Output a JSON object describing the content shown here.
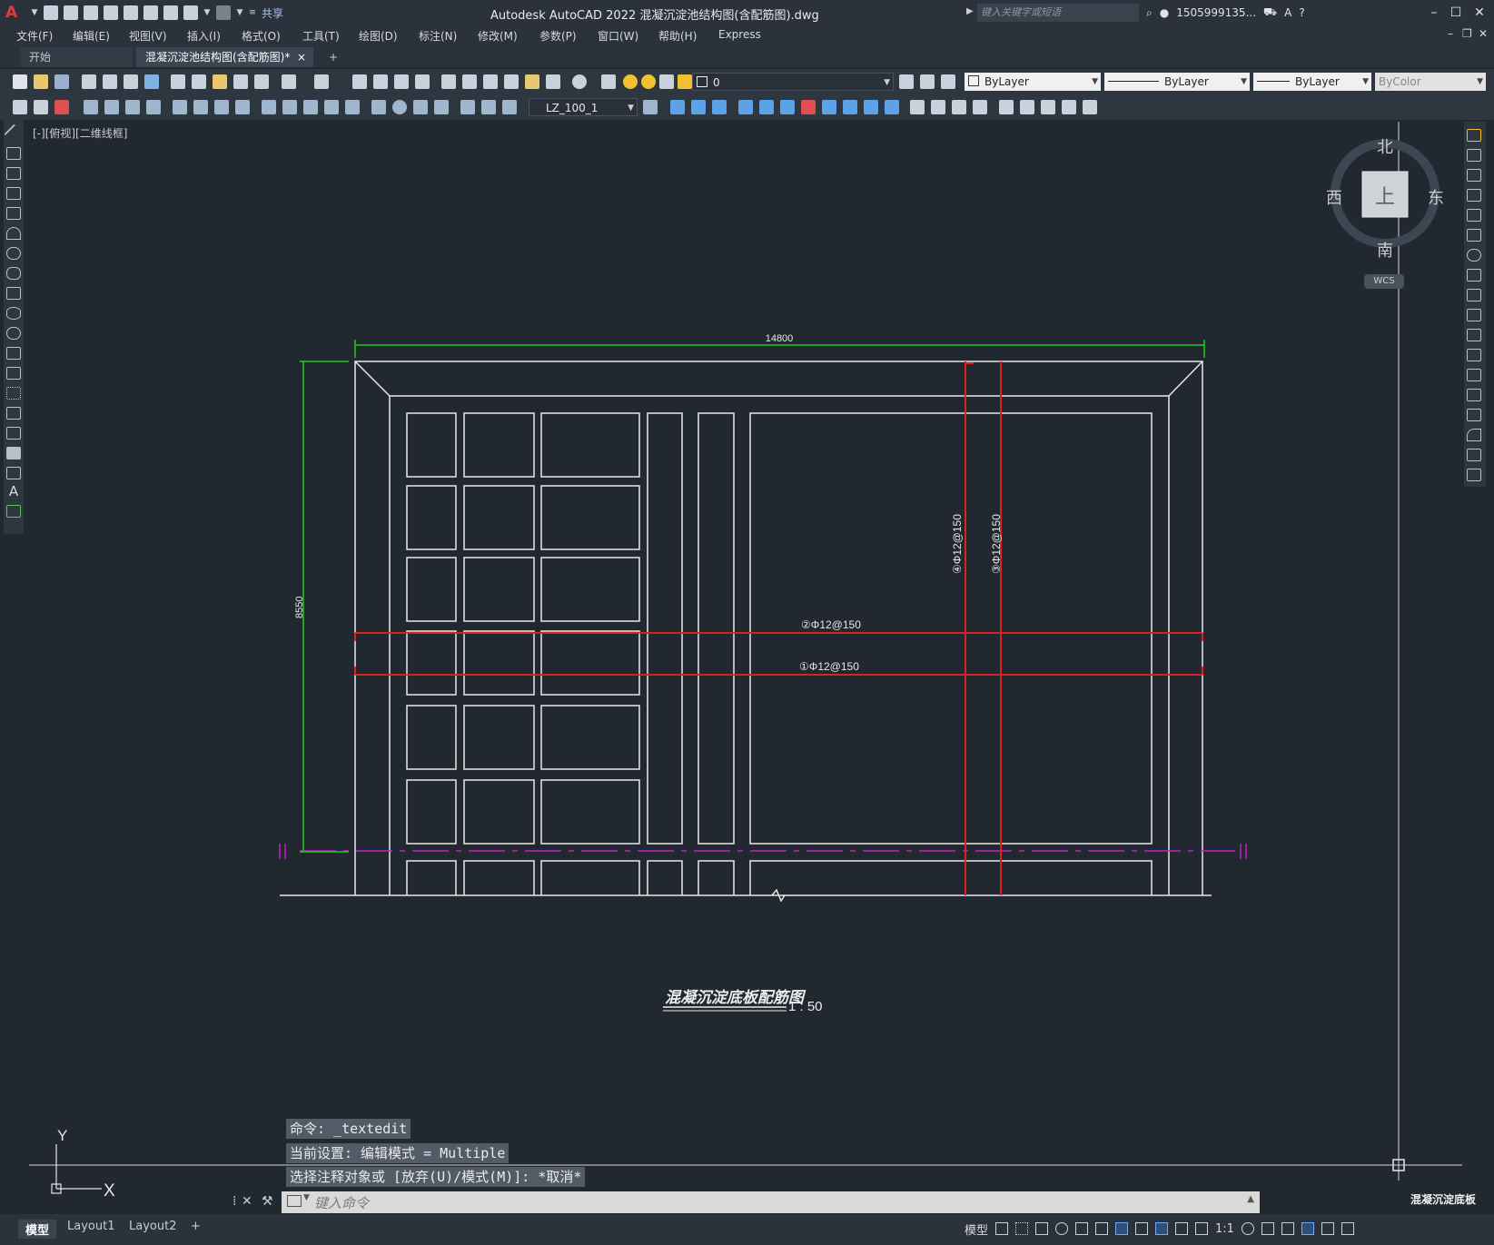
{
  "app": {
    "title": "Autodesk AutoCAD 2022    混凝沉淀池结构图(含配筋图).dwg",
    "share_label": "共享",
    "search_placeholder": "键入关键字或短语",
    "user": "1505999135...",
    "logo_letter": "A"
  },
  "menu": [
    "文件(F)",
    "编辑(E)",
    "视图(V)",
    "插入(I)",
    "格式(O)",
    "工具(T)",
    "绘图(D)",
    "标注(N)",
    "修改(M)",
    "参数(P)",
    "窗口(W)",
    "帮助(H)",
    "Express"
  ],
  "tabs": {
    "start": "开始",
    "document": "混凝沉淀池结构图(含配筋图)*",
    "close": "×",
    "new": "+"
  },
  "properties": {
    "layer": "0",
    "color": "ByLayer",
    "linetype": "ByLayer",
    "lineweight": "ByLayer",
    "plotstyle": "ByColor",
    "dimstyle": "LZ_100_1"
  },
  "viewport_label": "[-][俯视][二维线框]",
  "viewcube": {
    "north": "北",
    "south": "南",
    "east": "东",
    "west": "西",
    "face": "上",
    "wcs": "WCS"
  },
  "drawing": {
    "dim_width": "14800",
    "dim_height": "8550",
    "rebar_1": "①Φ12@150",
    "rebar_2": "②Φ12@150",
    "rebar_3": "③Φ12@150",
    "rebar_4": "④Φ12@150",
    "title": "混凝沉淀底板配筋图",
    "scale": "1 : 50",
    "corner_text": "混凝沉淀底板"
  },
  "ucs": {
    "x": "X",
    "y": "Y"
  },
  "command_history": [
    "命令: _textedit",
    "当前设置: 编辑模式 = Multiple",
    "选择注释对象或 [放弃(U)/模式(M)]: *取消*"
  ],
  "command_input_placeholder": "键入命令",
  "layout_tabs": [
    "模型",
    "Layout1",
    "Layout2",
    "+"
  ],
  "status": {
    "model": "模型",
    "scale": "1:1"
  },
  "colors": {
    "canvas": "#212830",
    "dimension": "#1ecc1e",
    "rebar": "#e01f1f",
    "centerline": "#c21fc2",
    "outline": "#e8e8e8"
  }
}
